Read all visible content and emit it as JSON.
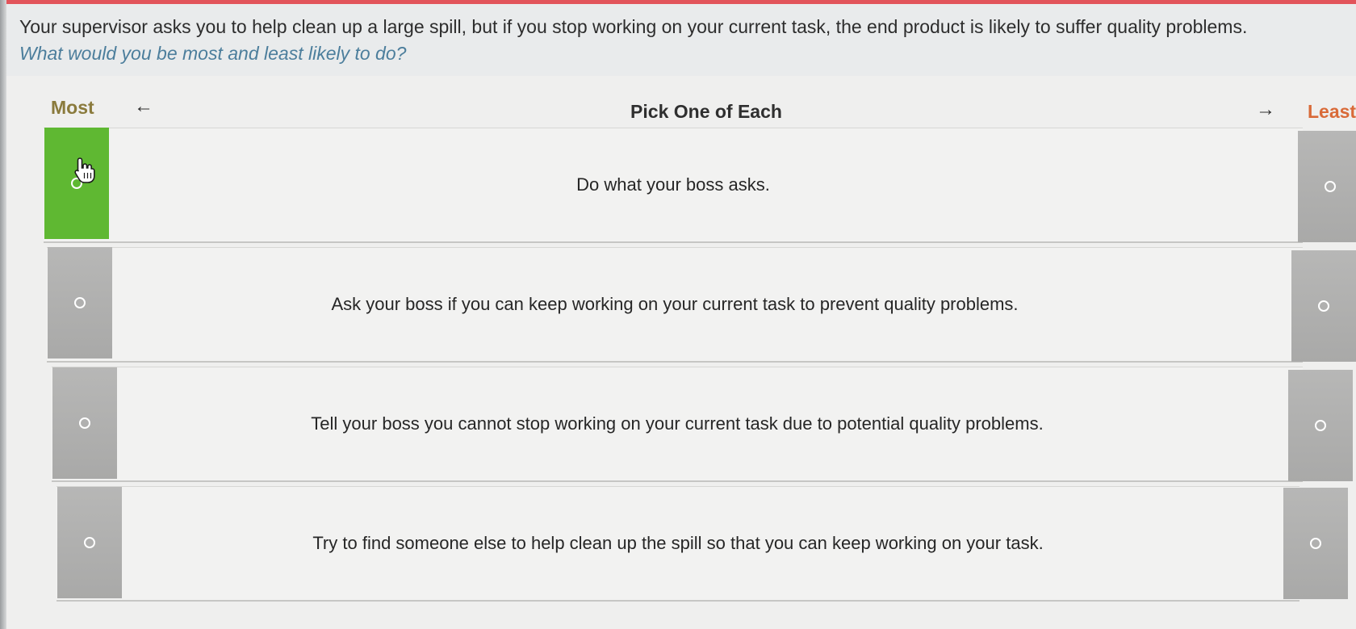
{
  "question": "Your supervisor asks you to help clean up a large spill, but if you stop working on your current task, the end product is likely to suffer quality problems.",
  "prompt": "What would you be most and least likely to do?",
  "header": {
    "most": "Most",
    "least": "Least",
    "instruction": "Pick One of Each",
    "left_arrow": "←",
    "right_arrow": "→"
  },
  "options": [
    {
      "text": "Do what your boss asks.",
      "most_selected": true,
      "least_selected": false
    },
    {
      "text": "Ask your boss if you can keep working on your current task to prevent quality problems.",
      "most_selected": false,
      "least_selected": false
    },
    {
      "text": "Tell your boss you cannot stop working on your current task due to potential quality problems.",
      "most_selected": false,
      "least_selected": false
    },
    {
      "text": "Try to find someone else to help clean up the spill so that you can keep working on your task.",
      "most_selected": false,
      "least_selected": false
    }
  ],
  "colors": {
    "selected": "#5fb832",
    "unselected_cell": "#b0b0af",
    "most_label": "#8a7a3c",
    "least_label": "#d96a38",
    "prompt": "#4c7e9c",
    "top_accent": "#e2545b"
  },
  "icons": {
    "cursor": "hand-pointer-icon",
    "radio": "radio-circle-icon"
  }
}
